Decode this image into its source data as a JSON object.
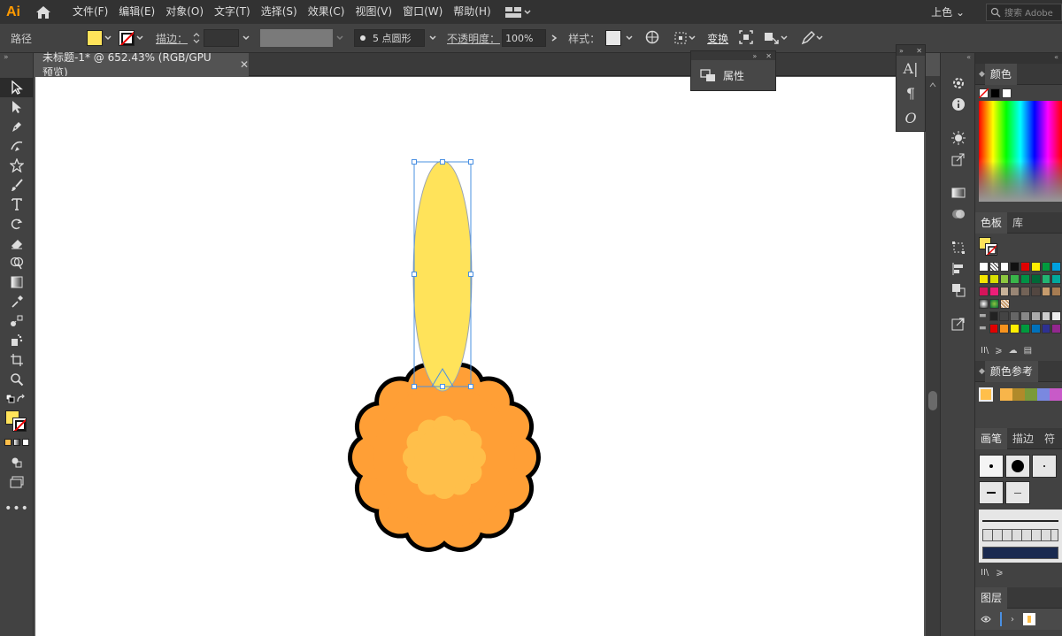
{
  "app": {
    "logo": "Ai"
  },
  "menu": [
    "文件(F)",
    "编辑(E)",
    "对象(O)",
    "文字(T)",
    "选择(S)",
    "效果(C)",
    "视图(V)",
    "窗口(W)",
    "帮助(H)"
  ],
  "topright": {
    "workspace": "上色",
    "search_placeholder": "搜索 Adobe"
  },
  "control": {
    "object_type": "路径",
    "stroke_label": "描边",
    "brush_label": "5 点圆形",
    "opacity_label": "不透明度",
    "opacity_value": "100%",
    "style_label": "样式",
    "transform_label": "变换",
    "fill_color": "#ffe35a"
  },
  "document": {
    "tab_title": "未标题-1* @ 652.43% (RGB/GPU 预览)"
  },
  "properties_panel": {
    "label": "属性"
  },
  "right_panels": {
    "color_tab": "颜色",
    "swatches_tab": "色板",
    "library_tab": "库",
    "color_guide_tab": "颜色参考",
    "brushes_tab": "画笔",
    "stroke_tab": "描边",
    "symbols_tab": "符",
    "layers_tab": "图层"
  },
  "colors": {
    "petal": "#ffe35a",
    "flower_outer": "#ff9f36",
    "flower_inner": "#ffbf4a",
    "outline": "#000000",
    "selection": "#4a90e2"
  }
}
